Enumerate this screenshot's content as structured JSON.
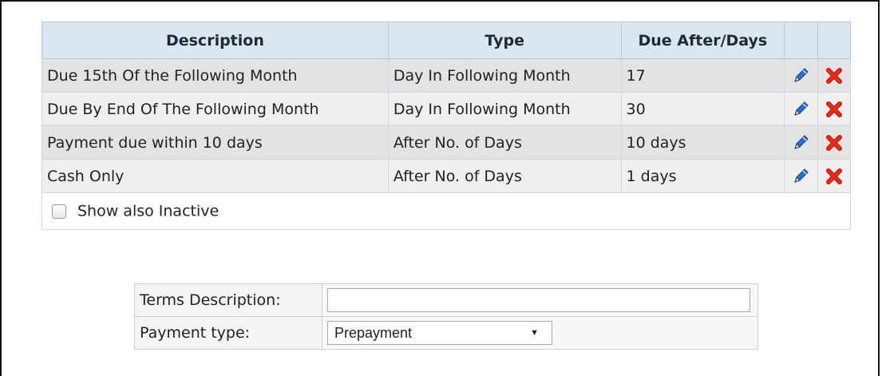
{
  "table": {
    "headers": {
      "description": "Description",
      "type": "Type",
      "due": "Due After/Days"
    },
    "rows": [
      {
        "description": "Due 15th Of the Following Month",
        "type": "Day In Following Month",
        "due": "17"
      },
      {
        "description": "Due By End Of The Following Month",
        "type": "Day In Following Month",
        "due": "30"
      },
      {
        "description": "Payment due within 10 days",
        "type": "After No. of Days",
        "due": "10 days"
      },
      {
        "description": "Cash Only",
        "type": "After No. of Days",
        "due": "1 days"
      }
    ],
    "show_inactive_label": "Show also Inactive"
  },
  "form": {
    "terms_label": "Terms Description:",
    "terms_value": "",
    "payment_label": "Payment type:",
    "payment_selected": "Prepayment"
  },
  "icons": {
    "edit": "pencil-icon",
    "delete": "delete-x-icon"
  },
  "colors": {
    "header_bg": "#dce6f0",
    "row_dark": "#e3e3e3",
    "row_light": "#efefef",
    "delete_red": "#e8291c",
    "pencil_blue": "#2a6fd1"
  }
}
